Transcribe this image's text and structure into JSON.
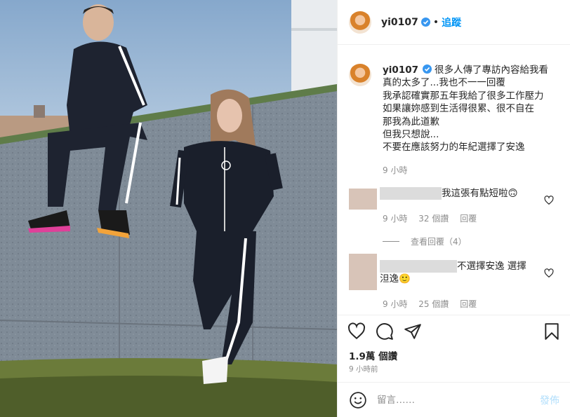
{
  "header": {
    "username": "yi0107",
    "separator": "•",
    "follow_label": "追蹤"
  },
  "caption": {
    "username": "yi0107",
    "text": "很多人傳了專訪內容給我看\n真的太多了...我也不一一回覆\n我承認確實那五年我給了很多工作壓力\n如果讓妳感到生活得很累、很不自在\n那我為此道歉\n但我只想說...\n不要在應該努力的年紀選擇了安逸",
    "time": "9 小時"
  },
  "comments": [
    {
      "text": "我這張有點短啦🙃",
      "time": "9 小時",
      "likes": "32 個讚",
      "reply": "回覆",
      "view_replies": "查看回覆（4）"
    },
    {
      "text": "不選擇安逸 選擇\n泹逸🙂",
      "time": "9 小時",
      "likes": "25 個讚",
      "reply": "回覆"
    }
  ],
  "stats": {
    "likes": "1.9萬 個讚",
    "posted": "9 小時前"
  },
  "add_comment": {
    "placeholder": "留言……",
    "post_label": "發佈"
  },
  "icons": {
    "verified": "verified-badge-icon",
    "heart": "heart-icon",
    "comment": "comment-icon",
    "share": "share-icon",
    "save": "bookmark-icon",
    "emoji": "emoji-icon"
  },
  "colors": {
    "accent": "#0095f6",
    "muted": "#8e8e8e",
    "post_disabled": "#b2dffc"
  }
}
